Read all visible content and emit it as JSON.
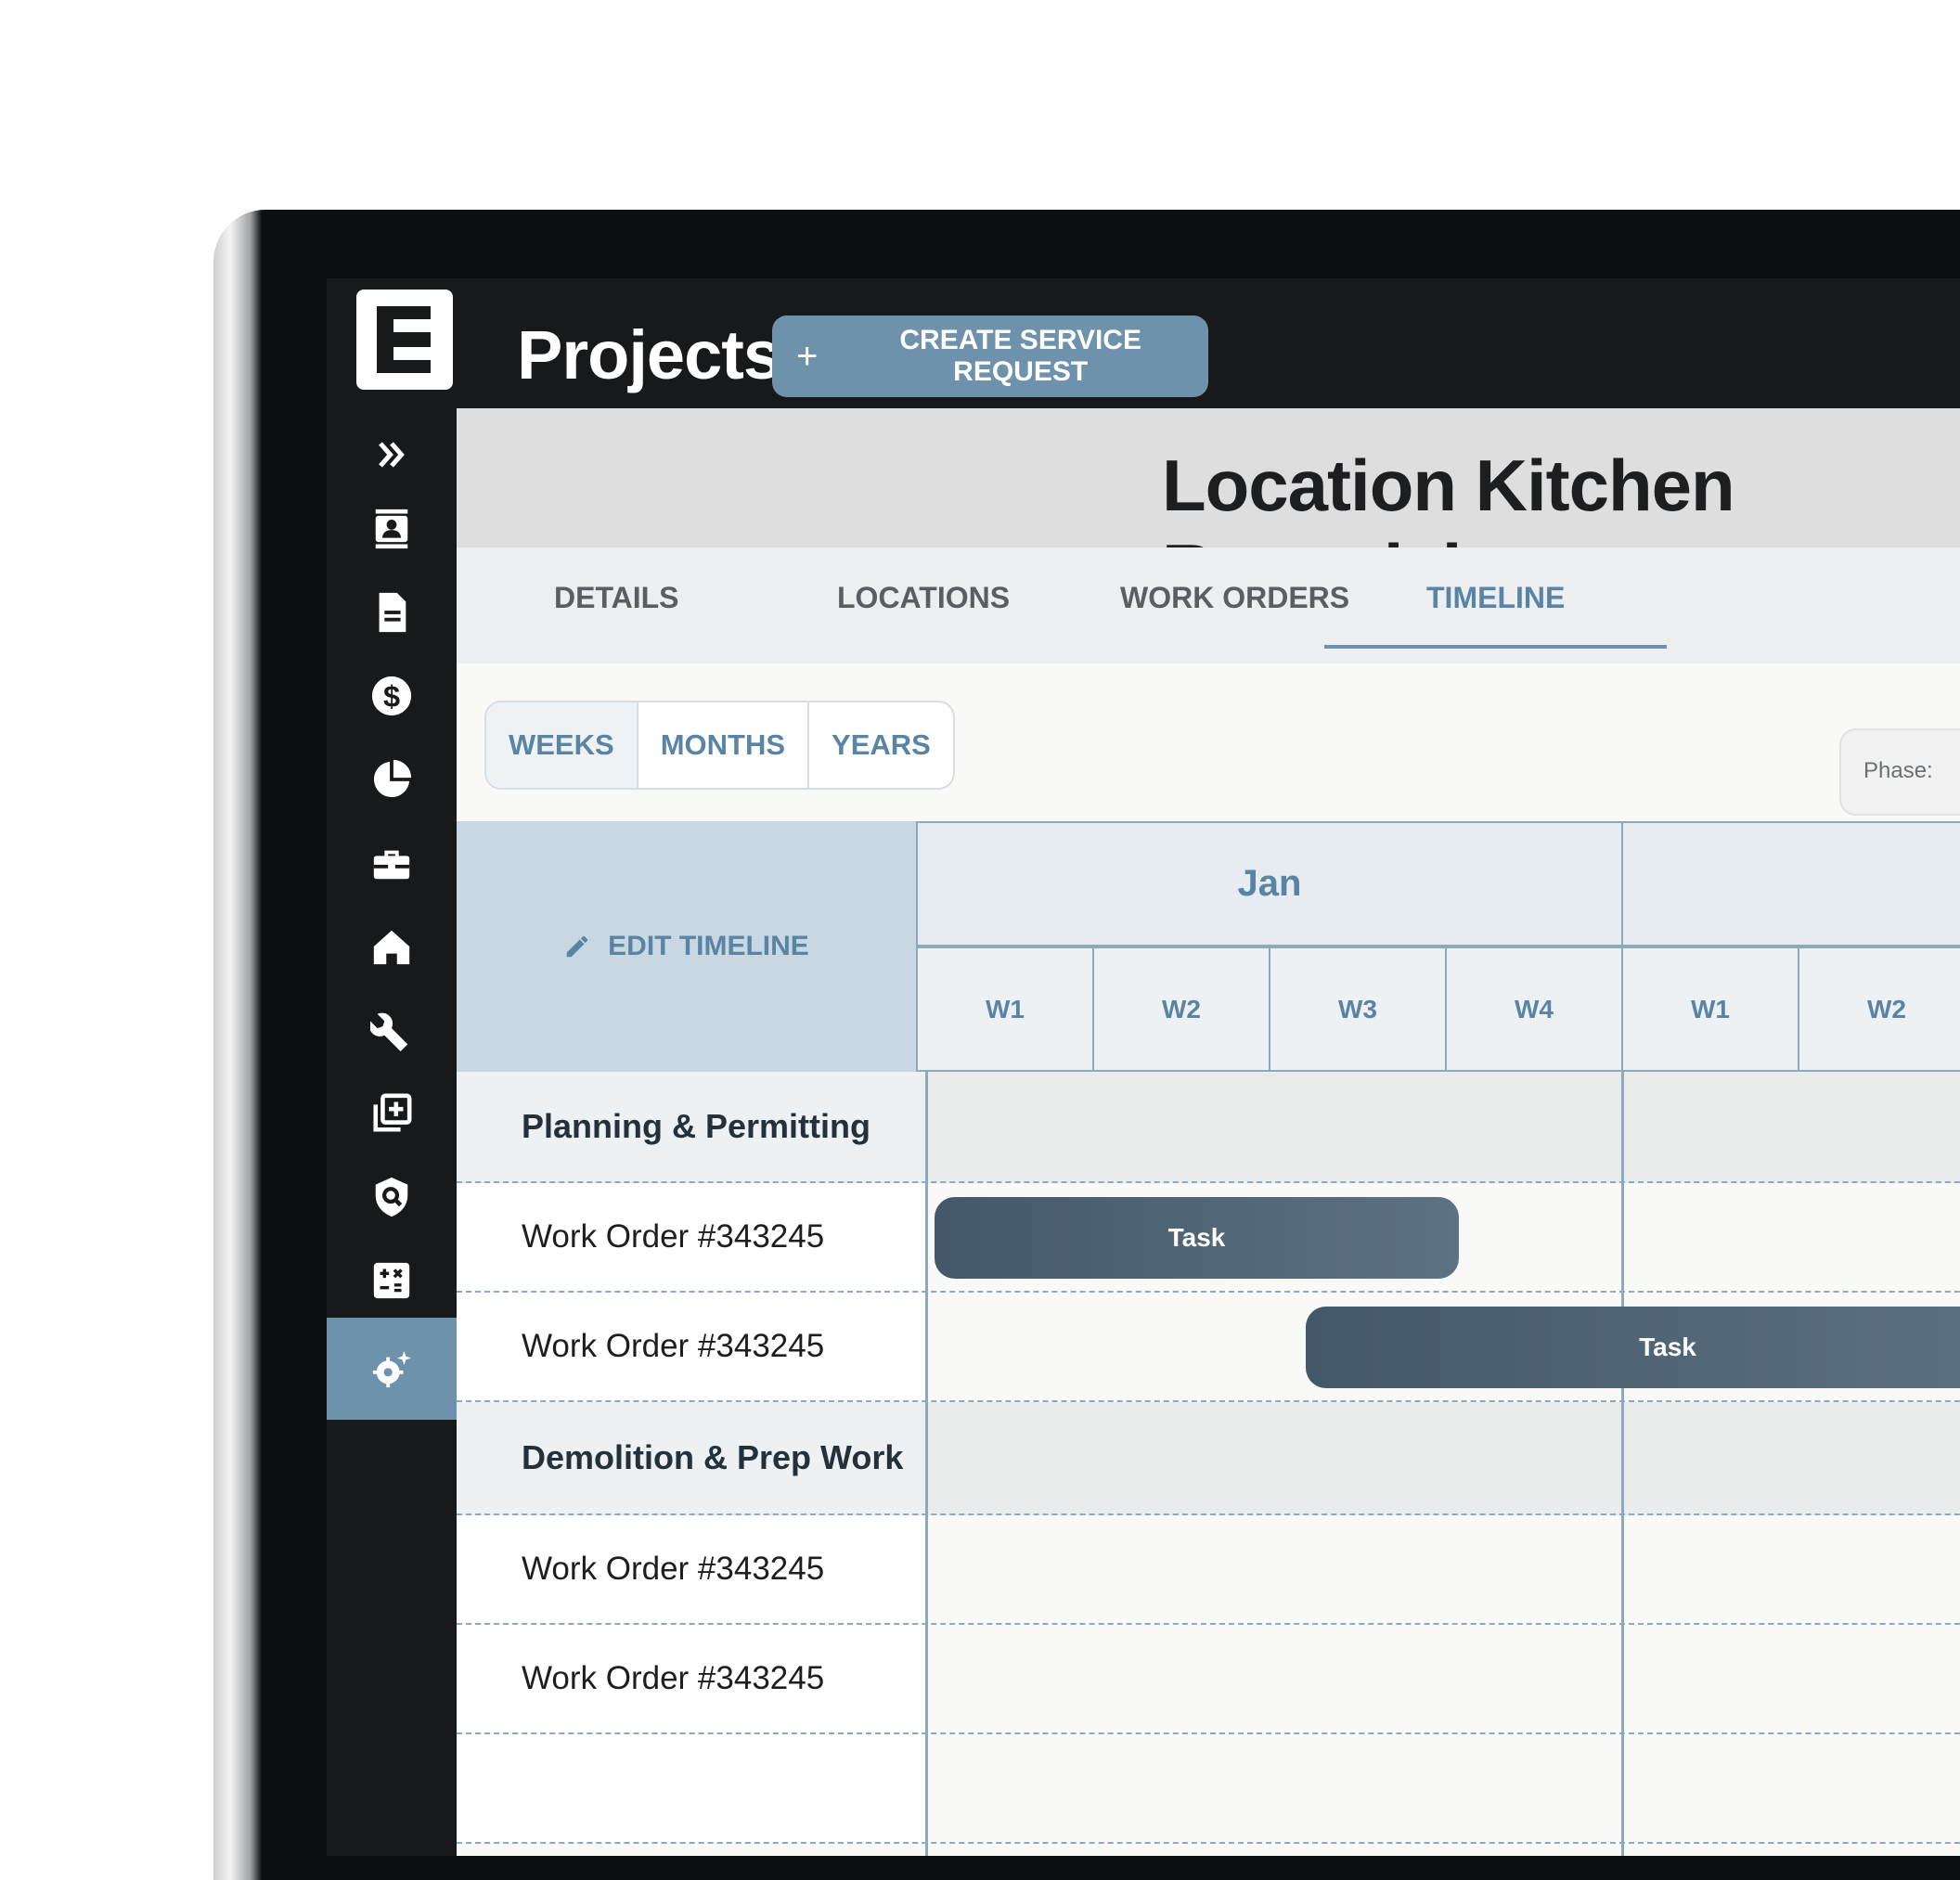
{
  "app": {
    "title": "Projects",
    "create_button_label": "CREATE SERVICE REQUEST"
  },
  "sidebar": {
    "items": [
      {
        "icon": "chevrons-right-icon"
      },
      {
        "icon": "contact-card-icon"
      },
      {
        "icon": "document-icon"
      },
      {
        "icon": "dollar-icon"
      },
      {
        "icon": "pie-chart-icon"
      },
      {
        "icon": "toolbox-icon"
      },
      {
        "icon": "house-icon"
      },
      {
        "icon": "wrench-icon"
      },
      {
        "icon": "add-copy-icon"
      },
      {
        "icon": "shield-search-icon"
      },
      {
        "icon": "calculator-icon"
      },
      {
        "icon": "settings-sparkle-icon",
        "active": true
      }
    ]
  },
  "project": {
    "title": "Location Kitchen Remodel"
  },
  "tabs": [
    {
      "label": "DETAILS"
    },
    {
      "label": "LOCATIONS"
    },
    {
      "label": "WORK ORDERS"
    },
    {
      "label": "TIMELINE",
      "active": true
    }
  ],
  "view_toggle": {
    "options": [
      "WEEKS",
      "MONTHS",
      "YEARS"
    ],
    "selected": "WEEKS"
  },
  "phase_filter": {
    "label": "Phase:"
  },
  "timeline": {
    "edit_label": "EDIT TIMELINE",
    "months": [
      "Jan",
      ""
    ],
    "weeks": [
      "W1",
      "W2",
      "W3",
      "W4",
      "W1",
      "W2"
    ],
    "rows": [
      {
        "type": "phase",
        "label": "Planning & Permitting"
      },
      {
        "type": "work_order",
        "label": "Work Order #343245",
        "task": "Task"
      },
      {
        "type": "work_order",
        "label": "Work Order #343245",
        "task": "Task"
      },
      {
        "type": "phase",
        "label": "Demolition & Prep Work"
      },
      {
        "type": "work_order",
        "label": "Work Order #343245"
      },
      {
        "type": "work_order",
        "label": "Work Order #343245"
      }
    ]
  },
  "colors": {
    "accent": "#6e92ab",
    "dark": "#18191b",
    "task": "#4f6474"
  }
}
